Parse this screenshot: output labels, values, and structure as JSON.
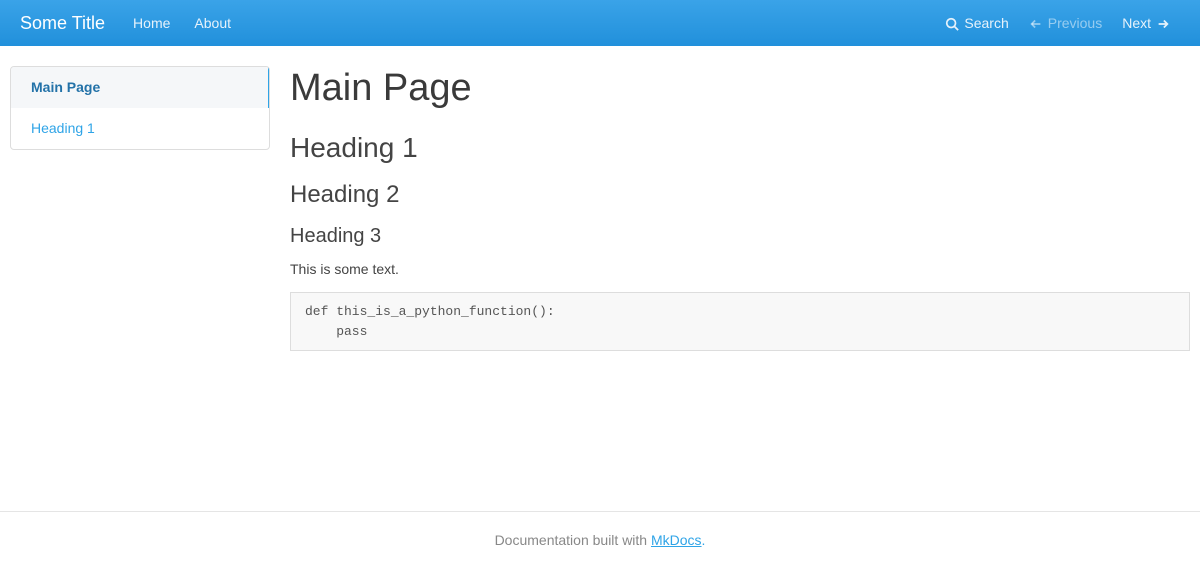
{
  "navbar": {
    "brand": "Some Title",
    "links": [
      {
        "label": "Home"
      },
      {
        "label": "About"
      }
    ],
    "search_label": "Search",
    "previous_label": "Previous",
    "next_label": "Next"
  },
  "sidebar": {
    "items": [
      {
        "label": "Main Page",
        "active": true
      },
      {
        "label": "Heading 1",
        "active": false
      }
    ]
  },
  "content": {
    "h1": "Main Page",
    "h2": "Heading 1",
    "h3": "Heading 2",
    "h4": "Heading 3",
    "paragraph": "This is some text.",
    "code": "def this_is_a_python_function():\n    pass"
  },
  "footer": {
    "text_prefix": "Documentation built with ",
    "link_text": "MkDocs",
    "suffix": "."
  }
}
